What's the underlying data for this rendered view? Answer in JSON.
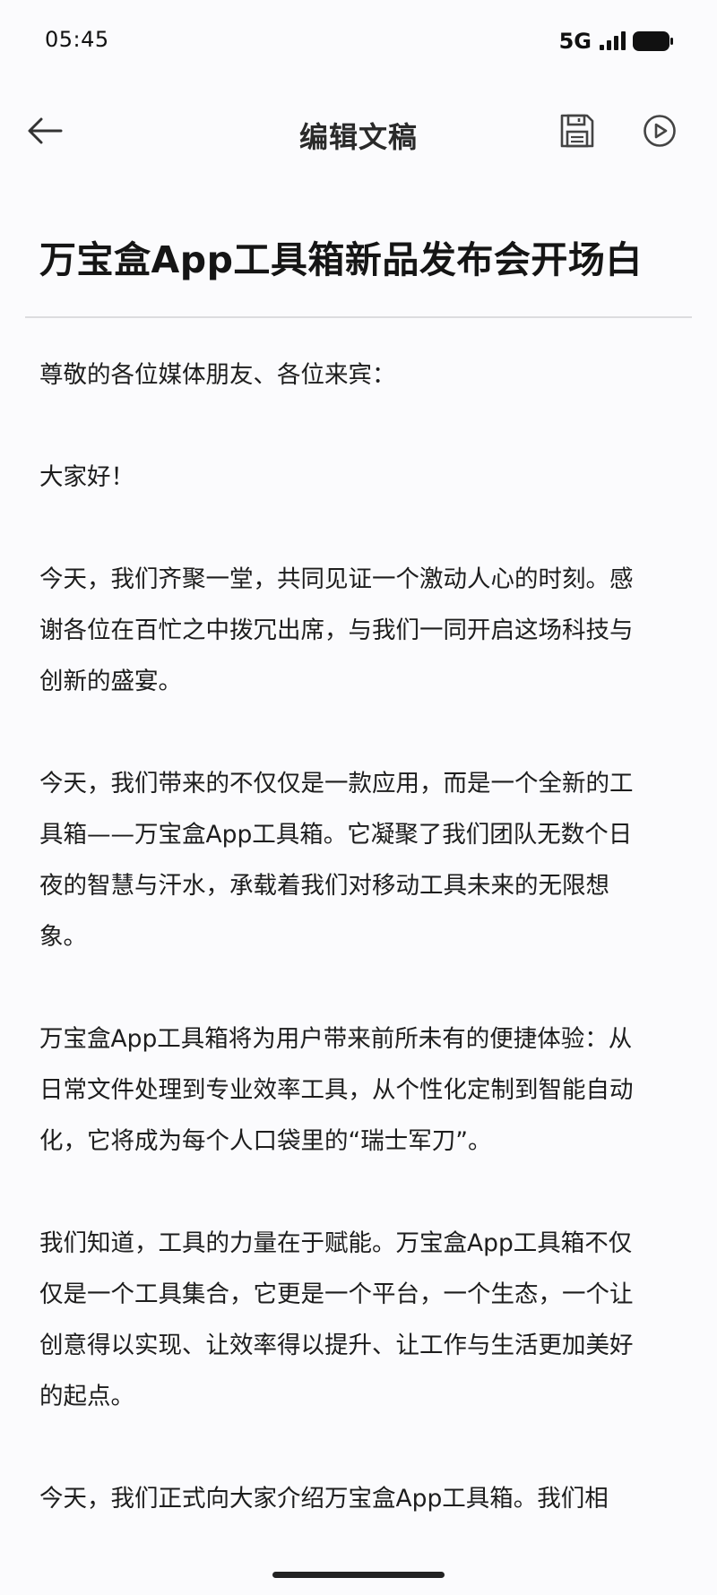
{
  "status_bar": {
    "time": "05:45",
    "network": "5G",
    "icons": [
      "signal-icon",
      "battery-icon"
    ]
  },
  "app_bar": {
    "title": "编辑文稿",
    "icons": [
      "back-arrow-icon",
      "save-icon",
      "play-icon"
    ]
  },
  "document": {
    "title": "万宝盒App工具箱新品发布会开场白",
    "paragraphs": [
      "尊敬的各位媒体朋友、各位来宾：",
      "大家好！",
      "今天，我们齐聚一堂，共同见证一个激动人心的时刻。感\n谢各位在百忙之中拨冗出席，与我们一同开启这场科技与\n创新的盛宴。",
      "今天，我们带来的不仅仅是一款应用，而是一个全新的工\n具箱——万宝盒App工具箱。它凝聚了我们团队无数个日\n夜的智慧与汗水，承载着我们对移动工具未来的无限想\n象。",
      "万宝盒App工具箱将为用户带来前所未有的便捷体验：从\n日常文件处理到专业效率工具，从个性化定制到智能自动\n化，它将成为每个人口袋里的“瑞士军刀”。",
      "我们知道，工具的力量在于赋能。万宝盒App工具箱不仅\n仅是一个工具集合，它更是一个平台，一个生态，一个让\n创意得以实现、让效率得以提升、让工作与生活更加美好\n的起点。",
      "今天，我们正式向大家介绍万宝盒App工具箱。我们相"
    ]
  }
}
